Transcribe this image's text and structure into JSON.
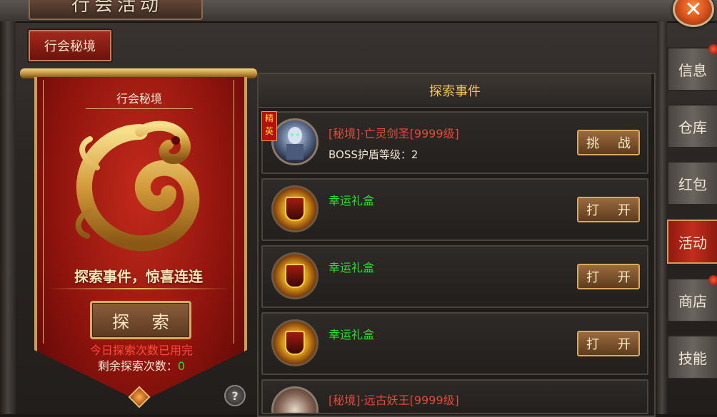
{
  "window": {
    "title": "行会活动",
    "close_icon": "close-icon"
  },
  "top_tab": {
    "label": "行会秘境"
  },
  "banner": {
    "title": "行会秘境",
    "slogan": "探索事件，惊喜连连",
    "explore_button": "探 索",
    "status": "今日探索次数已用完",
    "remaining_label": "剩余探索次数：",
    "remaining_count": "0",
    "help": "?"
  },
  "list": {
    "header": "探索事件",
    "events": [
      {
        "title": "[秘境]·亡灵剑圣[9999级]",
        "title_color": "#e24a3a",
        "subtitle": "BOSS护盾等级：2",
        "elite": "精英",
        "icon": "undead-swordsman-icon",
        "action": "挑 战"
      },
      {
        "title": "幸运礼盒",
        "title_color": "#27e02d",
        "subtitle": "",
        "elite": "",
        "icon": "lucky-box-icon",
        "action": "打 开"
      },
      {
        "title": "幸运礼盒",
        "title_color": "#27e02d",
        "subtitle": "",
        "elite": "",
        "icon": "lucky-box-icon",
        "action": "打 开"
      },
      {
        "title": "幸运礼盒",
        "title_color": "#27e02d",
        "subtitle": "",
        "elite": "",
        "icon": "lucky-box-icon",
        "action": "打 开"
      },
      {
        "title": "[秘境]·远古妖王[9999级]",
        "title_color": "#e24a3a",
        "subtitle": "",
        "elite": "",
        "icon": "boss-icon",
        "action": ""
      }
    ]
  },
  "side_tabs": [
    {
      "label": "信息",
      "active": false
    },
    {
      "label": "仓库",
      "active": false
    },
    {
      "label": "红包",
      "active": false
    },
    {
      "label": "活动",
      "active": true
    },
    {
      "label": "商店",
      "active": false
    },
    {
      "label": "技能",
      "active": false
    }
  ],
  "colors": {
    "accent_red": "#c22d1c",
    "gold": "#d9a863",
    "green": "#27e02d"
  }
}
